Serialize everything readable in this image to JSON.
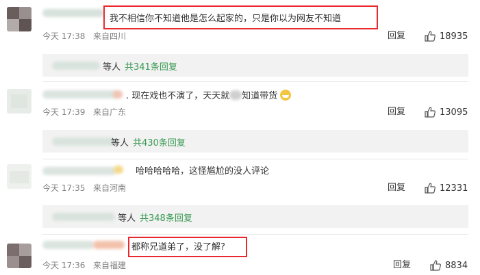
{
  "comments": [
    {
      "text": "我不相信你不知道他是怎么起家的，只是你以为网友不知道",
      "time": "今天 17:38",
      "location": "来自四川",
      "reply_label": "回复",
      "likes": "18935",
      "sub_suffix": "等人",
      "sub_count": "共341条回复"
    },
    {
      "text_a": ". 现在戏也不演了，天天就",
      "text_b": "知道带货",
      "time": "今天 17:39",
      "location": "来自广东",
      "reply_label": "回复",
      "likes": "13095",
      "sub_suffix": "等人",
      "sub_count": "共430条回复"
    },
    {
      "text": "哈哈哈哈哈，这怪尴尬的没人评论",
      "time": "今天 17:35",
      "location": "来自河南",
      "reply_label": "回复",
      "likes": "12331",
      "sub_suffix": "等人",
      "sub_count": "共348条回复"
    },
    {
      "text": "都称兄道弟了，没了解?",
      "time": "今天 17:36",
      "location": "来自福建",
      "reply_label": "回复",
      "likes": "8834"
    }
  ],
  "icons": {
    "like": "thumbs-up-icon",
    "emoji": "laughing-tears-emoji-icon"
  },
  "colors": {
    "highlight_border": "#e8282d",
    "reply_count": "#3a9a54",
    "meta": "#808080"
  }
}
